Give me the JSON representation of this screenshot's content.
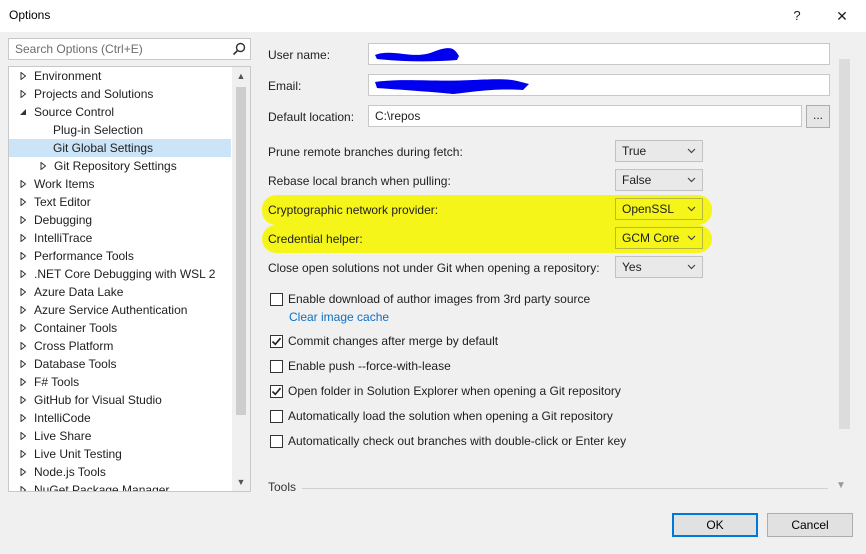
{
  "window": {
    "title": "Options",
    "help_label": "?",
    "close_label": "✕"
  },
  "search": {
    "placeholder": "Search Options (Ctrl+E)"
  },
  "tree": {
    "items": [
      {
        "label": "Environment",
        "expanded": false
      },
      {
        "label": "Projects and Solutions",
        "expanded": false
      },
      {
        "label": "Source Control",
        "expanded": true
      },
      {
        "label": "Plug-in Selection"
      },
      {
        "label": "Git Global Settings",
        "selected": true
      },
      {
        "label": "Git Repository Settings",
        "expanded": false
      },
      {
        "label": "Work Items",
        "expanded": false
      },
      {
        "label": "Text Editor",
        "expanded": false
      },
      {
        "label": "Debugging",
        "expanded": false
      },
      {
        "label": "IntelliTrace",
        "expanded": false
      },
      {
        "label": "Performance Tools",
        "expanded": false
      },
      {
        "label": ".NET Core Debugging with WSL 2",
        "expanded": false
      },
      {
        "label": "Azure Data Lake",
        "expanded": false
      },
      {
        "label": "Azure Service Authentication",
        "expanded": false
      },
      {
        "label": "Container Tools",
        "expanded": false
      },
      {
        "label": "Cross Platform",
        "expanded": false
      },
      {
        "label": "Database Tools",
        "expanded": false
      },
      {
        "label": "F# Tools",
        "expanded": false
      },
      {
        "label": "GitHub for Visual Studio",
        "expanded": false
      },
      {
        "label": "IntelliCode",
        "expanded": false
      },
      {
        "label": "Live Share",
        "expanded": false
      },
      {
        "label": "Live Unit Testing",
        "expanded": false
      },
      {
        "label": "Node.js Tools",
        "expanded": false
      },
      {
        "label": "NuGet Package Manager",
        "expanded": false
      }
    ]
  },
  "form": {
    "user_name_label": "User name:",
    "user_name_value": "",
    "email_label": "Email:",
    "email_value": "",
    "default_location_label": "Default location:",
    "default_location_value": "C:\\repos",
    "browse_label": "...",
    "prune_label": "Prune remote branches during fetch:",
    "prune_value": "True",
    "rebase_label": "Rebase local branch when pulling:",
    "rebase_value": "False",
    "crypto_label": "Cryptographic network provider:",
    "crypto_value": "OpenSSL",
    "credential_label": "Credential helper:",
    "credential_value": "GCM Core",
    "close_solutions_label": "Close open solutions not under Git when opening a repository:",
    "close_solutions_value": "Yes",
    "author_images_label": "Enable download of author images from 3rd party source",
    "author_images_checked": false,
    "clear_cache_link": "Clear image cache",
    "commit_after_merge_label": "Commit changes after merge by default",
    "commit_after_merge_checked": true,
    "push_force_label": "Enable push --force-with-lease",
    "push_force_checked": false,
    "open_folder_label": "Open folder in Solution Explorer when opening a Git repository",
    "open_folder_checked": true,
    "auto_load_label": "Automatically load the solution when opening a Git repository",
    "auto_load_checked": false,
    "auto_checkout_label": "Automatically check out branches with double-click or Enter key",
    "auto_checkout_checked": false,
    "tools_section_label": "Tools"
  },
  "buttons": {
    "ok_label": "OK",
    "cancel_label": "Cancel"
  },
  "colors": {
    "highlight": "#f5f51a",
    "selection": "#cce4f7",
    "link": "#0e70c0",
    "redaction": "#0000ee"
  }
}
